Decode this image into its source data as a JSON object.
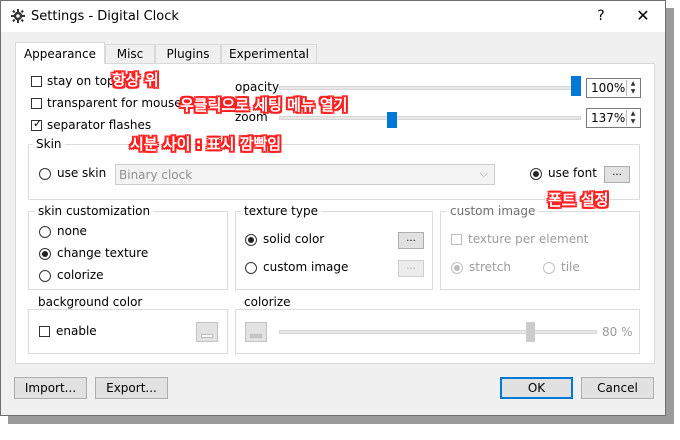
{
  "window": {
    "title": "Settings - Digital Clock",
    "help_glyph": "?",
    "close_glyph": "✕",
    "icon": "gear-icon"
  },
  "tabs": [
    {
      "label": "Appearance",
      "active": true
    },
    {
      "label": "Misc"
    },
    {
      "label": "Plugins"
    },
    {
      "label": "Experimental"
    }
  ],
  "options": {
    "stay_on_top": {
      "label": "stay on top",
      "checked": false
    },
    "transparent_for_mouse": {
      "label": "transparent for mouse",
      "checked": false
    },
    "separator_flashes": {
      "label": "separator flashes",
      "checked": true
    }
  },
  "opacity": {
    "label": "opacity",
    "value": "100%",
    "level_fraction": 1.0
  },
  "zoom": {
    "label": "zoom",
    "value": "137%",
    "level_fraction": 0.37
  },
  "skin": {
    "title": "Skin",
    "use_skin_label": "use skin",
    "skin_select_value": "Binary clock",
    "use_font_label": "use font",
    "use_font_selected": true,
    "font_button": "..."
  },
  "skin_customization": {
    "title": "skin customization",
    "options": [
      "none",
      "change texture",
      "colorize"
    ],
    "selected": "change texture"
  },
  "texture_type": {
    "title": "texture type",
    "solid_color_label": "solid color",
    "custom_image_label": "custom image",
    "selected": "solid color",
    "button": "..."
  },
  "custom_image": {
    "title": "custom image",
    "texture_per_element_label": "texture per element",
    "stretch_label": "stretch",
    "tile_label": "tile",
    "selected": "stretch"
  },
  "background_color": {
    "title": "background color",
    "enable_label": "enable",
    "enabled": false
  },
  "colorize": {
    "title": "colorize",
    "value_text": "80 %",
    "level_fraction": 0.8
  },
  "footer": {
    "import_label": "Import...",
    "export_label": "Export...",
    "ok_label": "OK",
    "cancel_label": "Cancel"
  },
  "annotations": {
    "stay_on_top": "항상 위",
    "right_click_menu": "우클릭으로 세팅 메뉴 열기",
    "separator_blink": "시분 사이 : 표시 깜빡임",
    "font_setting": "폰트 설정"
  },
  "colors": {
    "accent": "#0078d7",
    "annotation_outline": "#ff1e1e",
    "annotation_fill": "#ffffff"
  }
}
